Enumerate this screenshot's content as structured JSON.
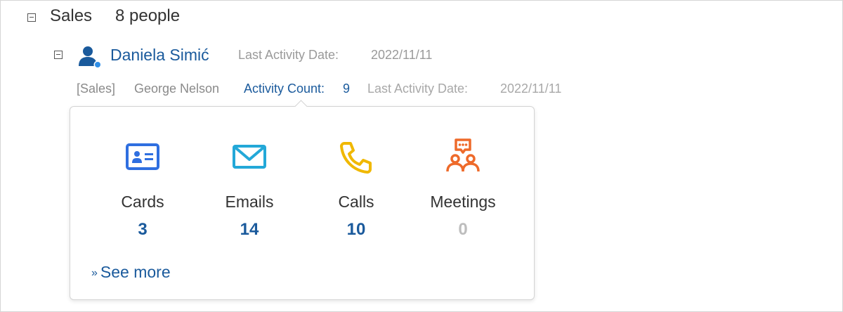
{
  "group": {
    "name": "Sales",
    "count_text": "8 people"
  },
  "person": {
    "name": "Daniela Simić",
    "last_activity_label": "Last Activity Date:",
    "last_activity_value": "2022/11/11"
  },
  "detail_row": {
    "department": "[Sales]",
    "member": "George Nelson",
    "activity_count_label": "Activity Count:",
    "activity_count_value": "9",
    "last_activity_label": "Last Activity Date:",
    "last_activity_value": "2022/11/11"
  },
  "popover": {
    "stats": [
      {
        "label": "Cards",
        "value": "3",
        "icon": "business-card-icon",
        "color": "#2f6fe0"
      },
      {
        "label": "Emails",
        "value": "14",
        "icon": "mail-icon",
        "color": "#23a8d8"
      },
      {
        "label": "Calls",
        "value": "10",
        "icon": "phone-icon",
        "color": "#f0b800"
      },
      {
        "label": "Meetings",
        "value": "0",
        "icon": "meeting-icon",
        "color": "#ee6a2a"
      }
    ],
    "see_more_prefix": "»",
    "see_more_label": "See more"
  },
  "colors": {
    "link": "#1a5a9c",
    "muted_text": "#9a9a9a",
    "zero_value": "#bdbdbd",
    "border": "#d6d6d6"
  }
}
